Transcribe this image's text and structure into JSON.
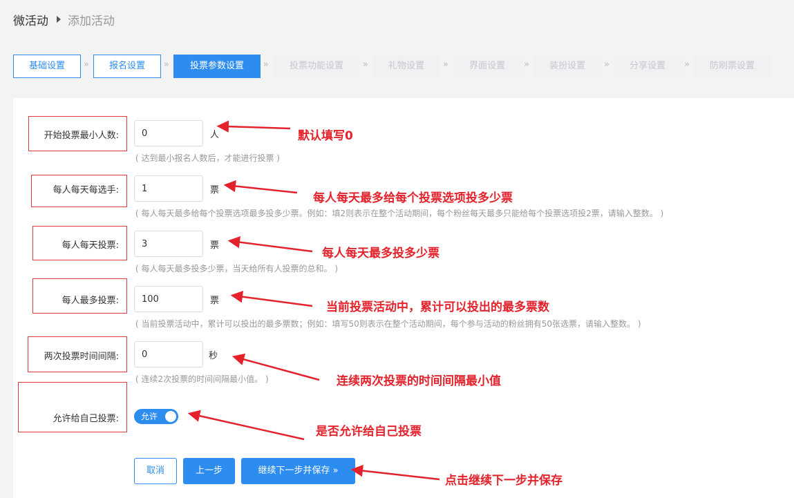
{
  "breadcrumb": {
    "root": "微活动",
    "current": "添加活动"
  },
  "steps": [
    "基础设置",
    "报名设置",
    "投票参数设置",
    "投票功能设置",
    "礼物设置",
    "界面设置",
    "装扮设置",
    "分享设置",
    "防刷票设置"
  ],
  "step_separator": "»",
  "form": {
    "min_voters": {
      "label": "开始投票最小人数:",
      "value": "0",
      "unit": "人",
      "hint": "( 达到最小报名人数后，才能进行投票 )"
    },
    "per_candidate_daily": {
      "label": "每人每天每选手:",
      "value": "1",
      "unit": "票",
      "hint": "( 每人每天最多给每个投票选项最多投多少票。例如：填2则表示在整个活动期间，每个粉丝每天最多只能给每个投票选项投2票，请输入整数。 )"
    },
    "daily_votes": {
      "label": "每人每天投票:",
      "value": "3",
      "unit": "票",
      "hint": "( 每人每天最多投多少票，当天给所有人投票的总和。 )"
    },
    "max_votes": {
      "label": "每人最多投票:",
      "value": "100",
      "unit": "票",
      "hint": "( 当前投票活动中，累计可以投出的最多票数；例如：填写50则表示在整个活动期间，每个参与活动的粉丝拥有50张选票，请输入整数。 )"
    },
    "vote_interval": {
      "label": "两次投票时间间隔:",
      "value": "0",
      "unit": "秒",
      "hint": "( 连续2次投票的时间间隔最小值。 )"
    },
    "allow_self_vote": {
      "label": "允许给自己投票:",
      "toggle_text": "允许",
      "enabled": true
    }
  },
  "buttons": {
    "cancel": "取消",
    "prev": "上一步",
    "next_save": "继续下一步并保存 »"
  },
  "annotations": {
    "min_voters": "默认填写0",
    "per_candidate_daily": "每人每天最多给每个投票选项投多少票",
    "daily_votes": "每人每天最多投多少票",
    "max_votes": "当前投票活动中，累计可以投出的最多票数",
    "vote_interval": "连续两次投票的时间间隔最小值",
    "allow_self_vote": "是否允许给自己投票",
    "next_save": "点击继续下一步并保存"
  },
  "colors": {
    "primary": "#2d8cf0",
    "annotation": "#e4222b",
    "hint": "#999999",
    "background": "#f3f3f4"
  }
}
